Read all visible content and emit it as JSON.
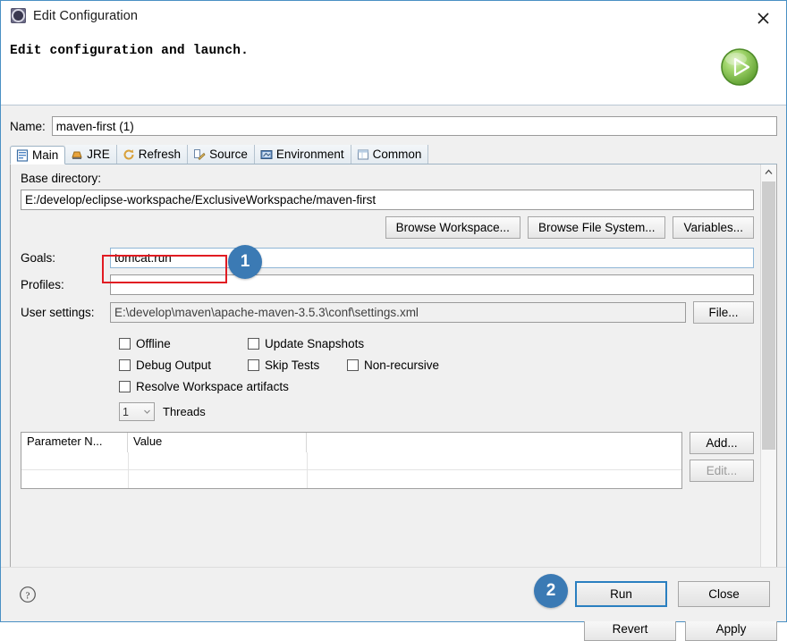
{
  "window": {
    "title": "Edit Configuration",
    "title_icon": "maven-config-icon",
    "close_icon": "close-icon",
    "banner_message": "Edit configuration and launch.",
    "banner_icon": "green-run-play-icon",
    "accent_color": "#3b7ab4",
    "annotation_color": "#e11b22"
  },
  "name_field": {
    "label": "Name:",
    "value": "maven-first (1)"
  },
  "tabs": [
    {
      "label": "Main",
      "icon": "main-page-icon",
      "active": true
    },
    {
      "label": "JRE",
      "icon": "jre-icon",
      "active": false
    },
    {
      "label": "Refresh",
      "icon": "refresh-icon",
      "active": false
    },
    {
      "label": "Source",
      "icon": "source-icon",
      "active": false
    },
    {
      "label": "Environment",
      "icon": "environment-icon",
      "active": false
    },
    {
      "label": "Common",
      "icon": "common-icon",
      "active": false
    }
  ],
  "main_tab": {
    "base_directory": {
      "label": "Base directory:",
      "value": "E:/develop/eclipse-workspache/ExclusiveWorkspache/maven-first"
    },
    "directory_buttons": [
      "Browse Workspace...",
      "Browse File System...",
      "Variables..."
    ],
    "goals": {
      "label": "Goals:",
      "value": "tomcat:run"
    },
    "profiles": {
      "label": "Profiles:",
      "value": ""
    },
    "user_settings": {
      "label": "User settings:",
      "value": "E:\\develop\\maven\\apache-maven-3.5.3\\conf\\settings.xml",
      "button": "File..."
    },
    "checkboxes": [
      {
        "label": "Offline",
        "checked": false
      },
      {
        "label": "Update Snapshots",
        "checked": false
      },
      {
        "label": "Debug Output",
        "checked": false
      },
      {
        "label": "Skip Tests",
        "checked": false
      },
      {
        "label": "Non-recursive",
        "checked": false
      },
      {
        "label": "Resolve Workspace artifacts",
        "checked": false
      }
    ],
    "threads": {
      "value": "1",
      "label": "Threads"
    },
    "parameters_table": {
      "columns": [
        "Parameter N...",
        "Value",
        ""
      ],
      "rows": [],
      "add_button": "Add...",
      "edit_button": "Edit..."
    }
  },
  "action_buttons": {
    "revert": "Revert",
    "apply": "Apply"
  },
  "footer": {
    "help_icon": "help-question-icon",
    "run": "Run",
    "close": "Close"
  },
  "annotations": [
    {
      "badge": "1",
      "target": "goals-input"
    },
    {
      "badge": "2",
      "target": "run-button"
    }
  ]
}
